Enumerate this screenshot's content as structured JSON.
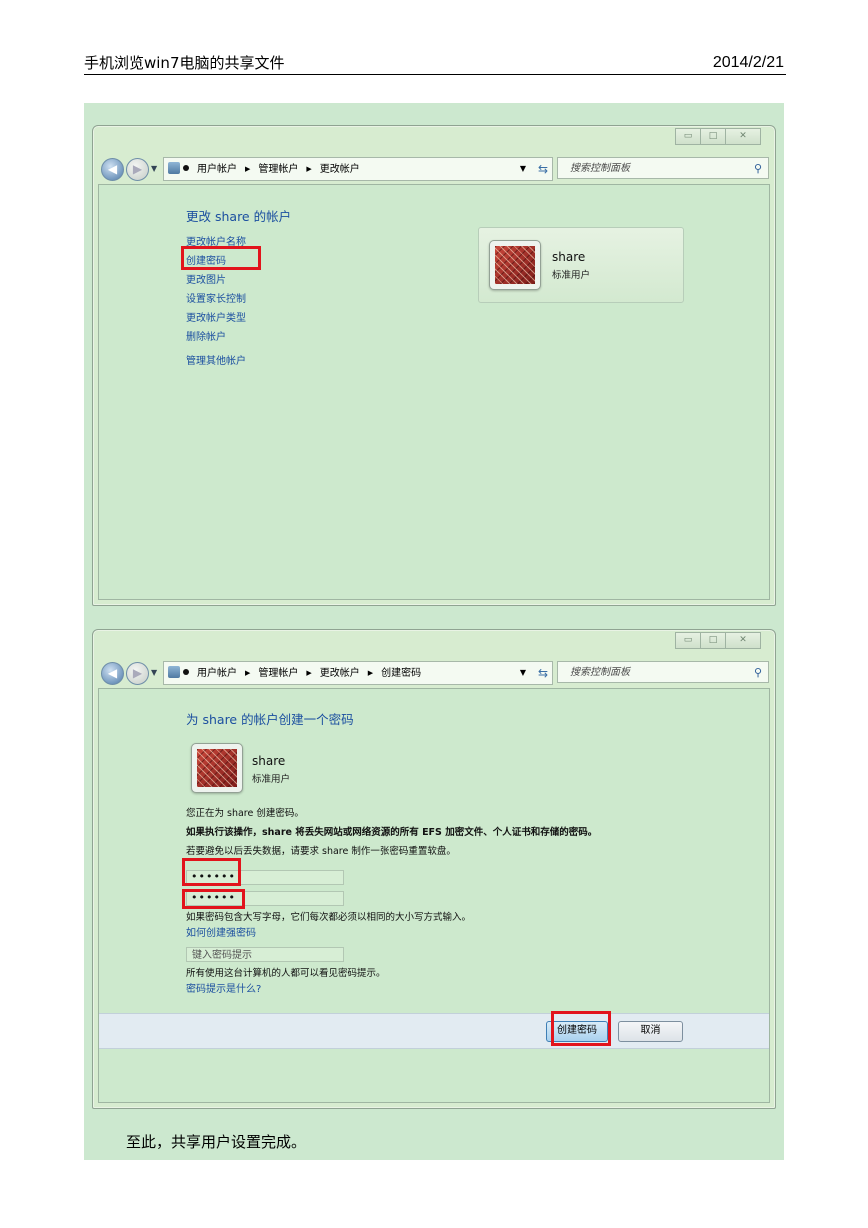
{
  "header": {
    "title": "手机浏览win7电脑的共享文件",
    "date": "2014/2/21"
  },
  "window1": {
    "breadcrumb": [
      "用户帐户",
      "管理帐户",
      "更改帐户"
    ],
    "search_placeholder": "搜索控制面板",
    "heading": "更改 share 的帐户",
    "links": [
      "更改帐户名称",
      "创建密码",
      "更改图片",
      "设置家长控制",
      "更改帐户类型",
      "删除帐户"
    ],
    "manage_other": "管理其他帐户",
    "user": {
      "name": "share",
      "role": "标准用户"
    }
  },
  "window2": {
    "breadcrumb": [
      "用户帐户",
      "管理帐户",
      "更改帐户",
      "创建密码"
    ],
    "search_placeholder": "搜索控制面板",
    "heading": "为 share 的帐户创建一个密码",
    "user": {
      "name": "share",
      "role": "标准用户"
    },
    "info_line": "您正在为 share 创建密码。",
    "warning_line": "如果执行该操作，share 将丢失网站或网络资源的所有 EFS 加密文件、个人证书和存储的密码。",
    "reset_line": "若要避免以后丢失数据，请要求 share 制作一张密码重置软盘。",
    "password_value": "••••••",
    "confirm_value": "••••••",
    "case_note": "如果密码包含大写字母，它们每次都必须以相同的大小写方式输入。",
    "strong_link": "如何创建强密码",
    "hint_placeholder": "键入密码提示",
    "hint_note": "所有使用这台计算机的人都可以看见密码提示。",
    "hint_link": "密码提示是什么?",
    "create_button": "创建密码",
    "cancel_button": "取消"
  },
  "caption": "至此，共享用户设置完成。"
}
